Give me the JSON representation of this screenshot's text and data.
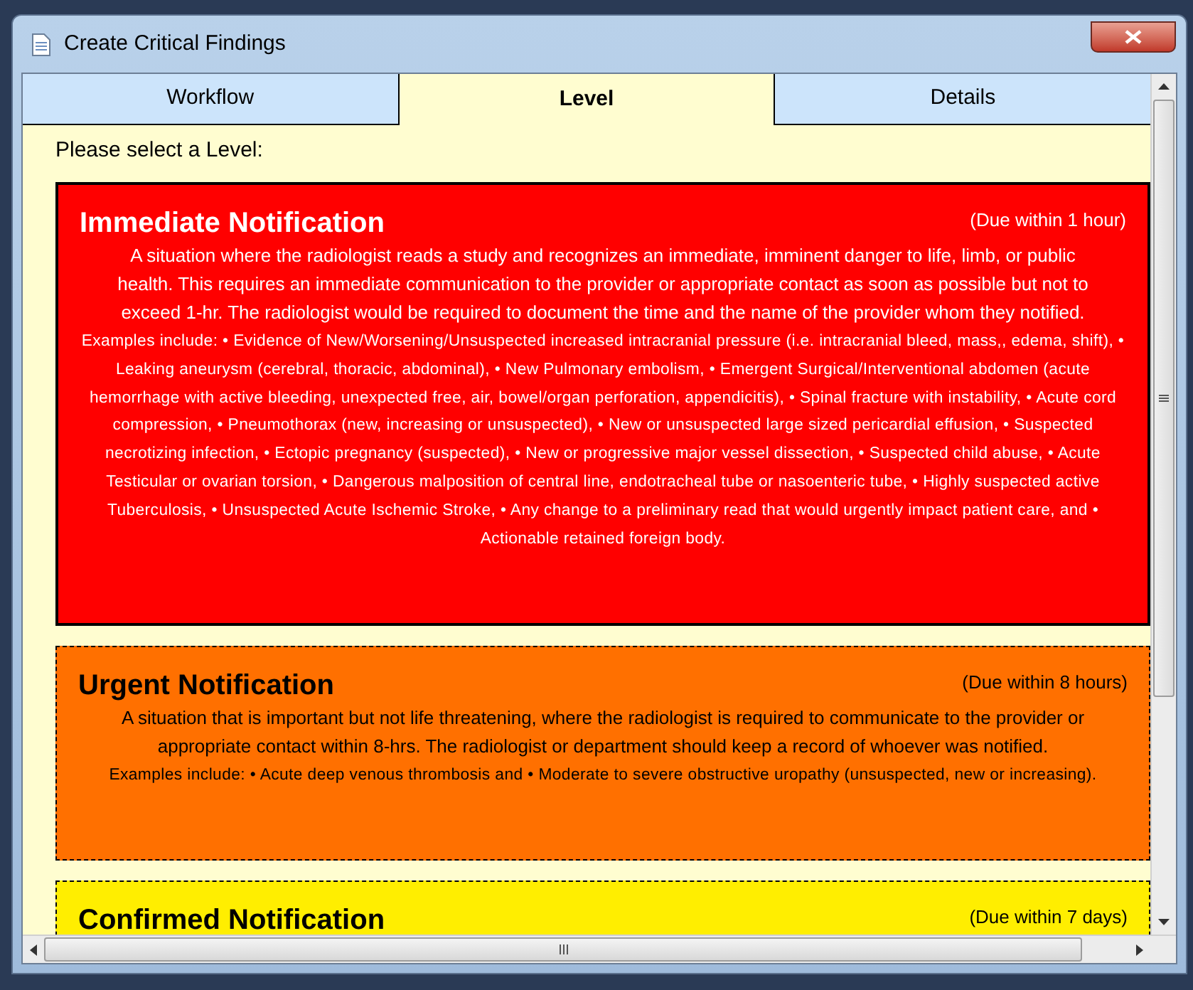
{
  "window": {
    "title": "Create Critical Findings"
  },
  "tabs": [
    {
      "label": "Workflow",
      "selected": false
    },
    {
      "label": "Level",
      "selected": true
    },
    {
      "label": "Details",
      "selected": false
    }
  ],
  "prompt": "Please select a Level:",
  "levels": [
    {
      "kind": "immediate",
      "selected": true,
      "title": "Immediate Notification",
      "due": "(Due within 1 hour)",
      "description": "A situation where the radiologist reads a study and recognizes an immediate, imminent danger to life, limb, or public health. This requires an immediate communication to the provider or appropriate contact as soon as possible but not to exceed 1-hr. The radiologist would be required to document the time and the name of the provider whom they notified.",
      "examples": "Examples include: • Evidence of New/Worsening/Unsuspected increased intracranial pressure (i.e. intracranial bleed, mass,, edema, shift), • Leaking aneurysm (cerebral, thoracic, abdominal), • New Pulmonary embolism, • Emergent Surgical/Interventional abdomen (acute hemorrhage with active bleeding, unexpected free, air, bowel/organ perforation, appendicitis), • Spinal fracture with instability, • Acute cord compression, • Pneumothorax (new, increasing or unsuspected), • New or unsuspected large sized pericardial effusion, • Suspected necrotizing infection, • Ectopic pregnancy (suspected), • New or progressive major vessel dissection, • Suspected child abuse, • Acute Testicular or ovarian torsion, • Dangerous malposition of central line, endotracheal tube or nasoenteric tube, • Highly suspected active Tuberculosis, • Unsuspected Acute Ischemic Stroke, • Any change to a preliminary read that would urgently impact patient care, and • Actionable retained foreign body."
    },
    {
      "kind": "urgent",
      "selected": false,
      "title": "Urgent Notification",
      "due": "(Due within 8 hours)",
      "description": "A situation that is important but not life threatening, where the radiologist is required to communicate to the provider or appropriate contact within 8-hrs. The radiologist or department should keep a record of whoever was notified.",
      "examples": "Examples include: • Acute deep venous thrombosis and • Moderate to severe obstructive uropathy (unsuspected, new or increasing)."
    },
    {
      "kind": "confirmed",
      "selected": false,
      "title": "Confirmed Notification",
      "due": "(Due within 7 days)"
    }
  ]
}
